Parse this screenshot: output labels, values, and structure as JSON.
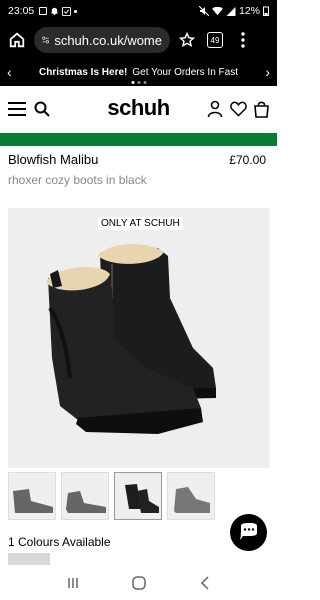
{
  "status": {
    "time": "23:05",
    "battery": "12%"
  },
  "browser": {
    "url": "schuh.co.uk/wome",
    "tab_count": "49"
  },
  "promo": {
    "bold": "Christmas Is Here!",
    "text": "Get Your Orders In Fast"
  },
  "header": {
    "logo": "schuh"
  },
  "product": {
    "name": "Blowfish Malibu",
    "price": "£70.00",
    "variant": "rhoxer cozy boots in black",
    "badge": "ONLY AT SCHUH",
    "colours": "1 Colours Available"
  },
  "colors": {
    "brand_green": "#0a7a35",
    "boot_black": "#1a1a1a",
    "faux_fur": "#e8d5b0"
  }
}
